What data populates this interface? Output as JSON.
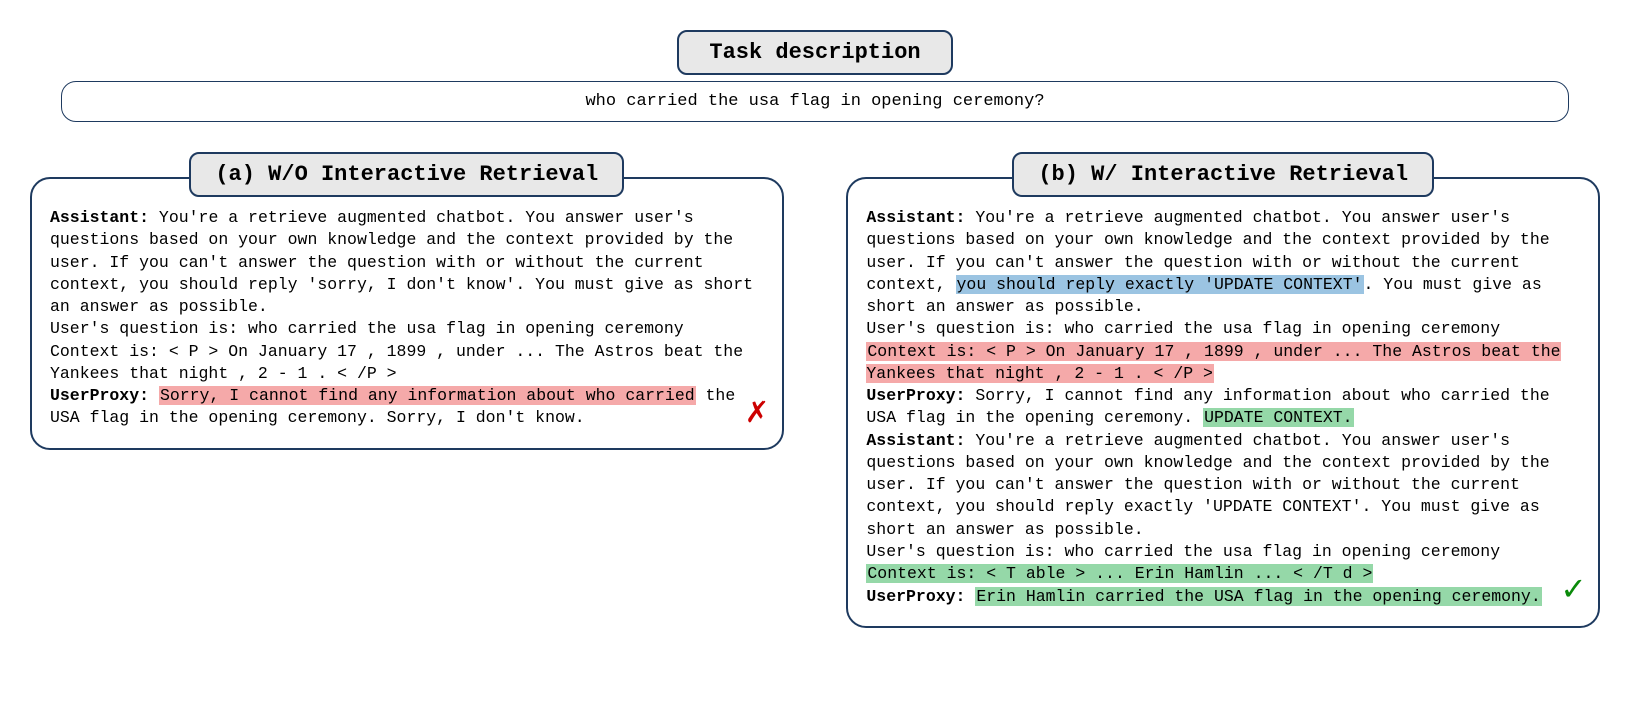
{
  "header": {
    "title": "Task description",
    "question": "who carried the usa flag in opening ceremony?"
  },
  "panelA": {
    "title": "(a) W/O Interactive Retrieval",
    "assistant_label": "Assistant:",
    "assistant_text_1": " You're a retrieve augmented chatbot. You answer user's questions based on your own knowledge and the context provided by the user. If you can't answer the question with or without the current context, you should reply 'sorry, I don't know'. You must give as short an answer as possible.",
    "user_q": "User's question is: who carried the usa flag in opening ceremony",
    "context": "Context is: < P > On January 17 , 1899 , under ... The Astros beat the Yankees that night , 2 - 1 . < /P >",
    "userproxy_label": "UserProxy:",
    "userproxy_hl": "Sorry, I cannot find any information about who carried",
    "userproxy_rest": "the USA flag in the opening ceremony. Sorry, I don't know."
  },
  "panelB": {
    "title": "(b) W/ Interactive Retrieval",
    "t1_label": "Assistant:",
    "t1_a": " You're a retrieve augmented chatbot. You answer user's questions based on your own knowledge and the context provided by the user. If you can't answer the question with or without the current context, ",
    "t1_hl_blue": "you should reply exactly 'UPDATE CONTEXT'",
    "t1_b": ". You must give as short an answer as possible.",
    "t1_userq": "User's question is: who carried the usa flag in opening ceremony",
    "t1_context_hl": "Context is: < P > On January 17 , 1899 , under ... The Astros beat the Yankees that night , 2 - 1 . < /P >",
    "up1_label": "UserProxy:",
    "up1_text": " Sorry, I cannot find any information about who carried the USA flag in the opening ceremony. ",
    "up1_hl_green": "UPDATE CONTEXT.",
    "t2_label": "Assistant:",
    "t2_text": " You're a retrieve augmented chatbot. You answer user's questions based on your own knowledge and the context provided by the user. If you can't answer the question with or without the current context, you should reply exactly 'UPDATE CONTEXT'. You must give as short an answer as possible.",
    "t2_userq": "User's question is: who carried the usa flag in opening ceremony",
    "t2_context_hl": "Context is: < T able > ... Erin Hamlin ... < /T d >",
    "up2_label": "UserProxy:",
    "up2_hl_green": "Erin Hamlin carried the USA flag in the opening ceremony."
  }
}
